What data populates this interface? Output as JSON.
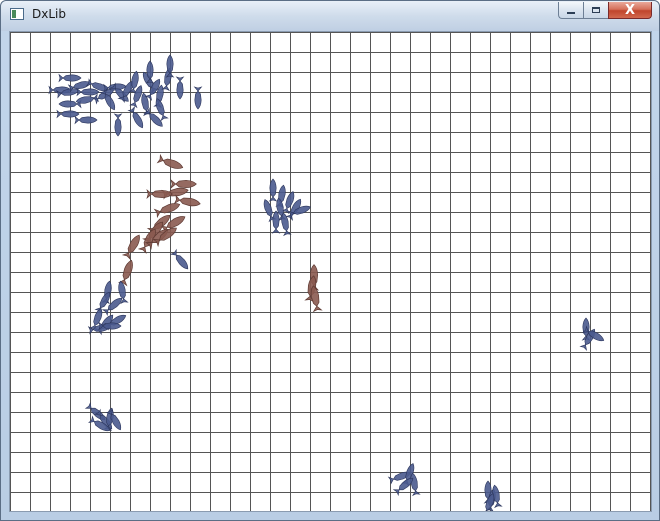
{
  "window": {
    "title": "DxLib",
    "minimize_label": "–",
    "maximize_label": "□",
    "close_label": "X"
  },
  "scene": {
    "grid": true,
    "grid_color": "#555555",
    "background": "#ffffff",
    "fish_blue_color": "#4a5a8e",
    "fish_brown_color": "#8a5a50",
    "schools": [
      {
        "name": "blue-school-top-left",
        "color": "blue"
      },
      {
        "name": "brown-school",
        "color": "brown"
      },
      {
        "name": "blue-school-mid-left",
        "color": "blue"
      },
      {
        "name": "blue-school-center",
        "color": "blue"
      },
      {
        "name": "brown-fish-single",
        "color": "brown"
      },
      {
        "name": "blue-school-right",
        "color": "blue"
      },
      {
        "name": "blue-school-bottom-left",
        "color": "blue"
      },
      {
        "name": "blue-school-bottom-center",
        "color": "blue"
      },
      {
        "name": "blue-school-bottom-right",
        "color": "blue"
      }
    ]
  }
}
